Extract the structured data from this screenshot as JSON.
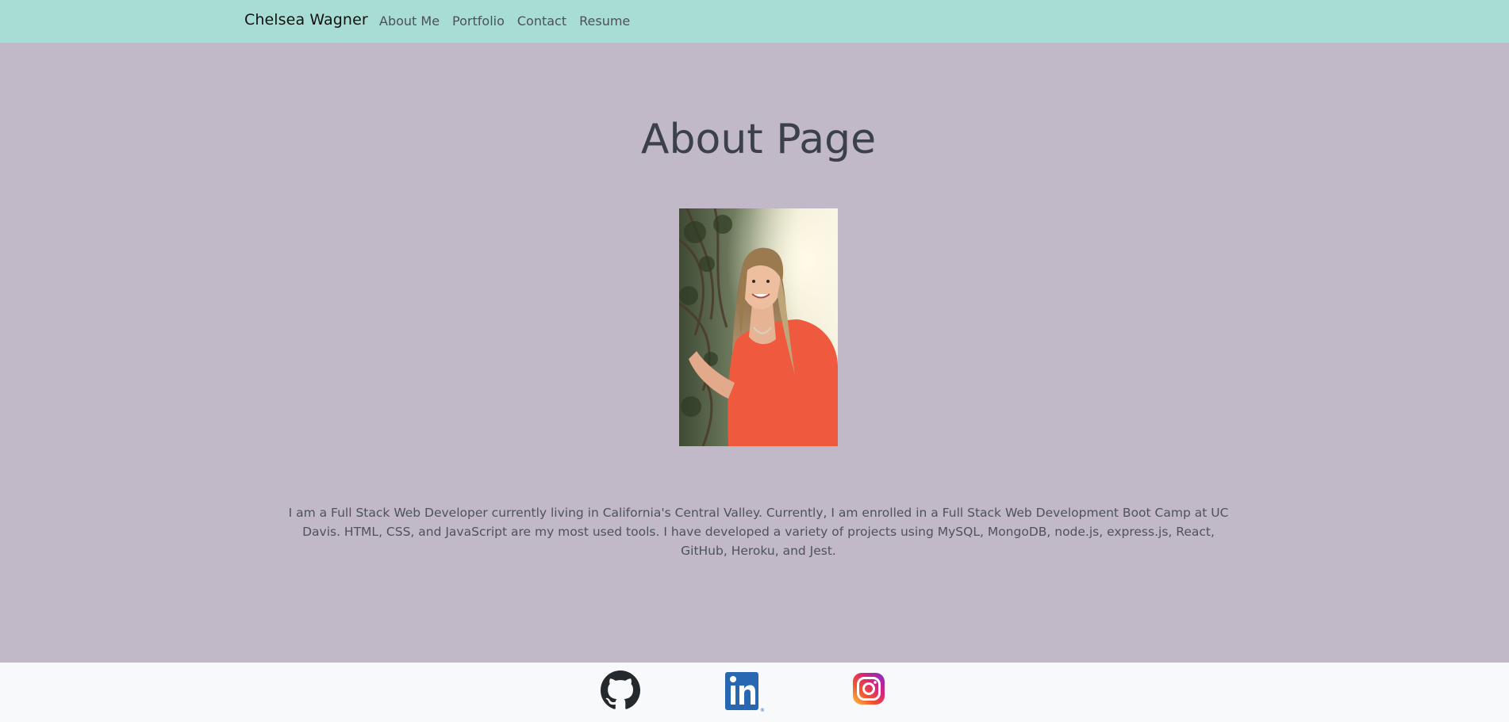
{
  "navbar": {
    "brand": "Chelsea Wagner",
    "links": [
      {
        "label": "About Me"
      },
      {
        "label": "Portfolio"
      },
      {
        "label": "Contact"
      },
      {
        "label": "Resume"
      }
    ]
  },
  "main": {
    "title": "About Page",
    "bio": "I am a Full Stack Web Developer currently living in California's Central Valley. Currently, I am enrolled in a Full Stack Web Development Boot Camp at UC Davis. HTML, CSS, and JavaScript are my most used tools. I have developed a variety of projects using MySQL, MongoDB, node.js, express.js, React, GitHub, Heroku, and Jest."
  },
  "footer": {
    "icons": [
      "github-icon",
      "linkedin-icon",
      "instagram-icon"
    ]
  },
  "colors": {
    "navbar_bg": "#a8ddd5",
    "page_bg": "#c1b8c8",
    "footer_bg": "#f8f9fa",
    "title_color": "#3b4049"
  }
}
